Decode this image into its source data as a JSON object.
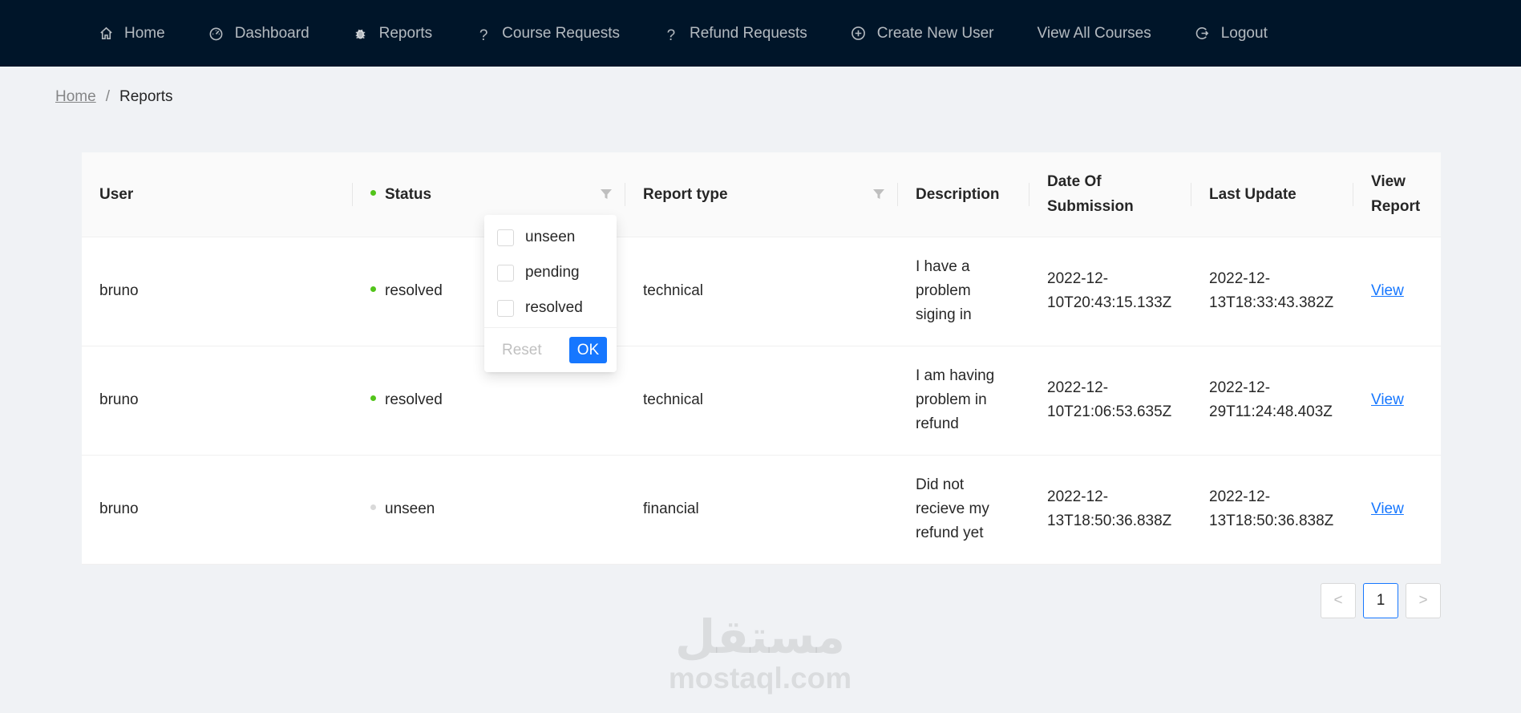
{
  "nav": {
    "items": [
      {
        "label": "Home",
        "icon": "home-icon"
      },
      {
        "label": "Dashboard",
        "icon": "dashboard-icon"
      },
      {
        "label": "Reports",
        "icon": "bug-icon"
      },
      {
        "label": "Course Requests",
        "icon": "question-icon"
      },
      {
        "label": "Refund Requests",
        "icon": "question-icon"
      },
      {
        "label": "Create New User",
        "icon": "plus-circle-icon"
      },
      {
        "label": "View All Courses",
        "icon": ""
      },
      {
        "label": "Logout",
        "icon": "logout-icon"
      }
    ]
  },
  "breadcrumb": {
    "home": "Home",
    "separator": "/",
    "current": "Reports"
  },
  "table": {
    "columns": {
      "user": "User",
      "status": "Status",
      "report_type": "Report type",
      "description": "Description",
      "date_of_submission": "Date Of Submission",
      "last_update": "Last Update",
      "view_report": "View Report"
    },
    "rows": [
      {
        "user": "bruno",
        "status": "resolved",
        "status_color": "#52c41a",
        "report_type": "technical",
        "description": "I have a problem siging in",
        "date_of_submission": "2022-12-10T20:43:15.133Z",
        "last_update": "2022-12-13T18:33:43.382Z",
        "view": "View"
      },
      {
        "user": "bruno",
        "status": "resolved",
        "status_color": "#52c41a",
        "report_type": "technical",
        "description": "I am having problem in refund",
        "date_of_submission": "2022-12-10T21:06:53.635Z",
        "last_update": "2022-12-29T11:24:48.403Z",
        "view": "View"
      },
      {
        "user": "bruno",
        "status": "unseen",
        "status_color": "#d9d9d9",
        "report_type": "financial",
        "description": "Did not recieve my refund yet",
        "date_of_submission": "2022-12-13T18:50:36.838Z",
        "last_update": "2022-12-13T18:50:36.838Z",
        "view": "View"
      }
    ]
  },
  "status_filter": {
    "options": [
      {
        "label": "unseen",
        "checked": false
      },
      {
        "label": "pending",
        "checked": false
      },
      {
        "label": "resolved",
        "checked": false
      }
    ],
    "reset_label": "Reset",
    "ok_label": "OK"
  },
  "pagination": {
    "prev": "<",
    "current_page": "1",
    "next": ">"
  },
  "watermark": {
    "arabic": "مستقل",
    "latin": "mostaql.com"
  },
  "colors": {
    "nav_background": "#001529",
    "page_background": "#f0f2f5",
    "accent": "#1677ff",
    "resolved": "#52c41a",
    "unseen": "#d9d9d9"
  }
}
